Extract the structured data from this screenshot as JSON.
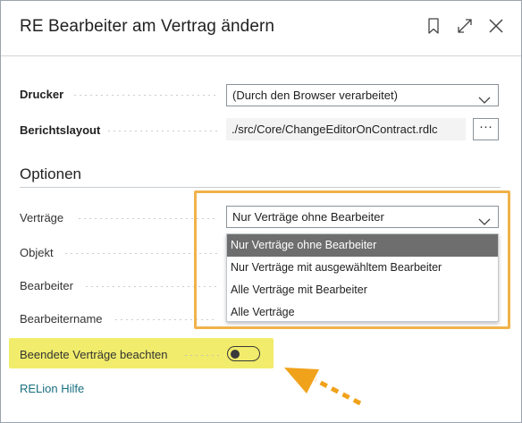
{
  "dialog": {
    "title": "RE Bearbeiter am Vertrag ändern",
    "icons": [
      "bookmark-icon",
      "expand-icon",
      "close-icon"
    ]
  },
  "fields": {
    "drucker": {
      "label": "Drucker",
      "value": "(Durch den Browser verarbeitet)"
    },
    "berichtslayout": {
      "label": "Berichtslayout",
      "value": "./src/Core/ChangeEditorOnContract.rdlc",
      "button": "···"
    }
  },
  "optionen": {
    "heading": "Optionen",
    "vertraege": {
      "label": "Verträge",
      "value": "Nur Verträge ohne Bearbeiter",
      "options": [
        "Nur Verträge ohne Bearbeiter",
        "Nur Verträge mit ausgewähltem Bearbeiter",
        "Alle Verträge mit Bearbeiter",
        "Alle Verträge"
      ],
      "selected_index": 0
    },
    "objekt": {
      "label": "Objekt"
    },
    "bearbeiter": {
      "label": "Bearbeiter"
    },
    "bearbeitername": {
      "label": "Bearbeitername"
    },
    "beendete": {
      "label": "Beendete Verträge beachten",
      "toggle_on": false
    }
  },
  "footer": {
    "link": "RELion Hilfe"
  },
  "colors": {
    "highlight_border": "#f0b24a",
    "highlight_row": "#f1ec6b",
    "arrow": "#f0a21a",
    "link": "#1a6f80",
    "selected_option": "#6e6e6e"
  }
}
